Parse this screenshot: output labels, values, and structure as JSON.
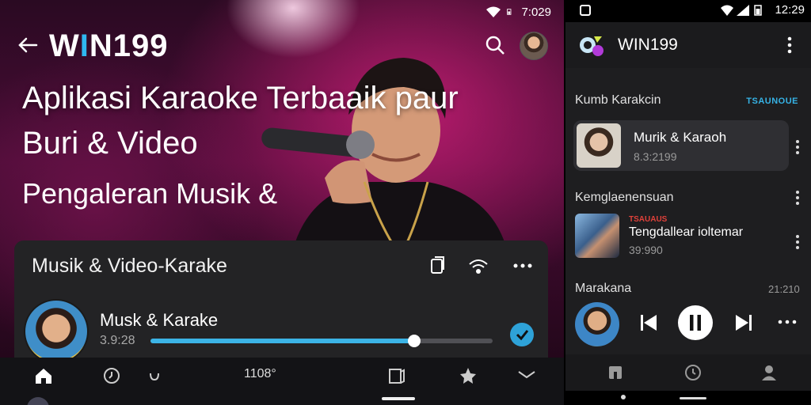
{
  "left": {
    "status": {
      "time": "7:029"
    },
    "header": {
      "logo_w": "W",
      "logo_i": "I",
      "logo_rest": "N199"
    },
    "hero": {
      "line1": "Aplikasi Karaoke Terbaaik paur",
      "line2": "Buri & Video",
      "line3": "Pengaleran Musik  &"
    },
    "card": {
      "title": "Musik & Video-Karake",
      "track_title": "Musk & Karake",
      "track_time": "3.9:28",
      "progress": 0.77
    },
    "bottom_nav": {
      "center_label": "1108°"
    },
    "icons": {
      "back": "arrow-left-icon",
      "search": "search-icon",
      "copy": "copy-icon",
      "cast": "cast-icon",
      "more": "more-horizontal-icon",
      "check": "check-circle-icon",
      "home": "home-icon",
      "history": "history-icon",
      "loop": "loop-icon",
      "library": "library-icon",
      "star": "star-icon",
      "mail": "mail-icon"
    },
    "colors": {
      "accent": "#3cb4e6",
      "card_bg": "#232325"
    }
  },
  "right": {
    "status": {
      "time": "12:29"
    },
    "appbar": {
      "title": "WIN199"
    },
    "section1": {
      "title": "Kumb Karakcin",
      "tag": "TSAUNOUE"
    },
    "item1": {
      "title": "Murik & Karaoh",
      "sub": "8.3:2199"
    },
    "section2": {
      "title": "Kemglaenensuan"
    },
    "item2": {
      "badge": "TSAUAUS",
      "title": "Tengdal​lear ioltemar",
      "sub": "39:990"
    },
    "section3": {
      "title": "Marakana",
      "value": "21:210"
    },
    "icons": {
      "logo": "app-logo-icon",
      "kebab": "more-vertical-icon",
      "prev": "skip-previous-icon",
      "pause": "pause-icon",
      "next": "skip-next-icon",
      "more": "more-horizontal-icon",
      "lib": "library-icon",
      "recent": "history-icon",
      "profile": "profile-icon"
    },
    "colors": {
      "accent": "#36b3e6",
      "badge": "#e0413a"
    }
  }
}
